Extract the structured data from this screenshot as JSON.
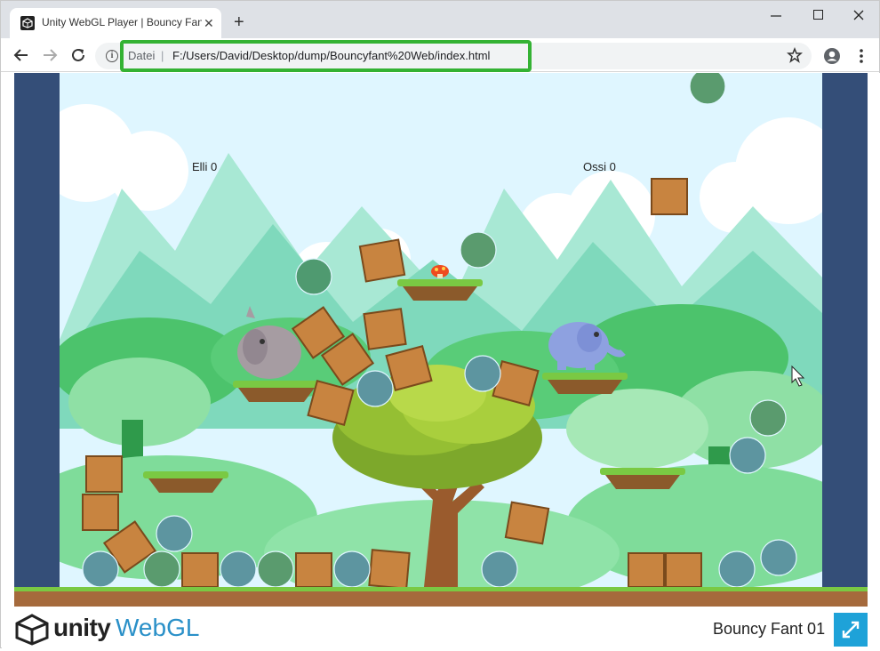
{
  "browser": {
    "tab_title": "Unity WebGL Player | Bouncy Fant",
    "url_prefix": "Datei",
    "url": "F:/Users/David/Desktop/dump/Bouncyfant%20Web/index.html",
    "highlight_color": "#34b233"
  },
  "game": {
    "player1_label": "Elli 0",
    "player2_label": "Ossi 0",
    "colors": {
      "frame": "#344e78",
      "sky": "#dff6ff",
      "grass": "#7ac943",
      "dirt": "#a56a3c"
    }
  },
  "footer": {
    "unity_word": "unity",
    "webgl_word": "WebGL",
    "game_title": "Bouncy Fant 01",
    "fullscreen_color": "#1ea2d8"
  }
}
